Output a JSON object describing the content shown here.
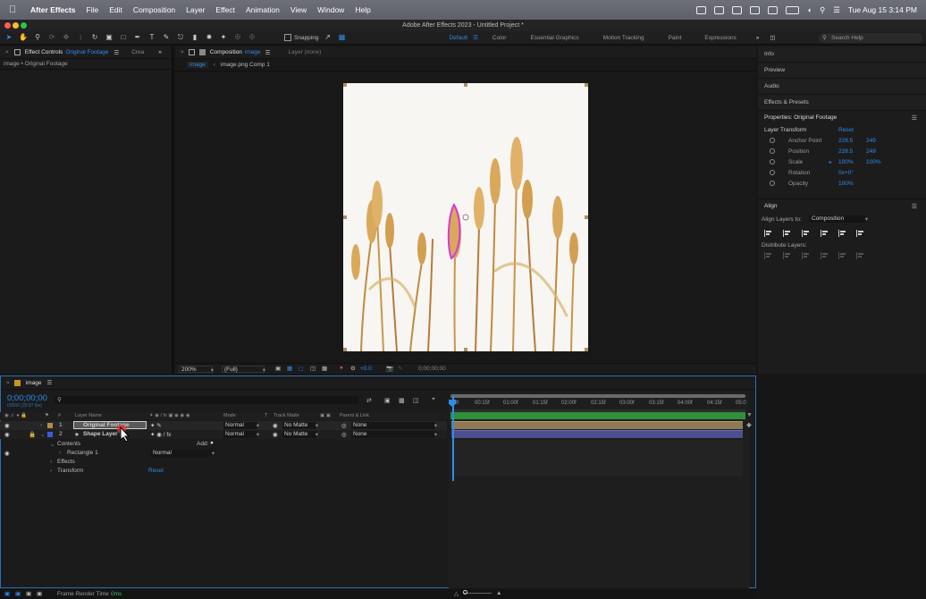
{
  "menubar": {
    "app_name": "After Effects",
    "items": [
      "File",
      "Edit",
      "Composition",
      "Layer",
      "Effect",
      "Animation",
      "View",
      "Window",
      "Help"
    ],
    "clock": "Tue Aug 15  3:14 PM"
  },
  "window": {
    "title": "Adobe After Effects 2023 - Untitled Project *"
  },
  "toolbar": {
    "snapping_label": "Snapping",
    "workspaces": [
      "Default",
      "Color",
      "Essential Graphics",
      "Motion Tracking",
      "Paint",
      "Expressions"
    ],
    "active_workspace": "Default",
    "search_placeholder": "Search Help"
  },
  "effect_controls": {
    "tab_label": "Effect Controls",
    "tab_layer": "Original Footage",
    "tab2_label": "Crea",
    "breadcrumb": "image • Original Footage"
  },
  "composition": {
    "tab_label": "Composition",
    "tab_comp": "image",
    "layer_tab": "Layer (none)",
    "nav_current": "image",
    "nav_child": "image.png Comp 1",
    "zoom": "200%",
    "resolution": "(Full)",
    "exposure": "+0.0",
    "timecode": "0;00;00;00"
  },
  "right_panel": {
    "sections": [
      "Info",
      "Preview",
      "Audio",
      "Effects & Presets"
    ],
    "properties_title": "Properties: Original Footage",
    "layer_transform": "Layer Transform",
    "reset_label": "Reset",
    "properties": [
      {
        "label": "Anchor Point",
        "v1": "228.5",
        "v2": "249"
      },
      {
        "label": "Position",
        "v1": "228.5",
        "v2": "249"
      },
      {
        "label": "Scale",
        "v1": "100%",
        "v2": "100%"
      },
      {
        "label": "Rotation",
        "v1": "0x+0°",
        "v2": ""
      },
      {
        "label": "Opacity",
        "v1": "100%",
        "v2": ""
      }
    ],
    "align_title": "Align",
    "align_layers_to_label": "Align Layers to:",
    "align_layers_to_value": "Composition",
    "distribute_label": "Distribute Layers:"
  },
  "timeline": {
    "tab_label": "image",
    "timecode": "0;00;00;00",
    "fps": "00000 (29.97 fps)",
    "columns": {
      "layer_name": "Layer Name",
      "mode": "Mode",
      "t": "T",
      "track_matte": "Track Matte",
      "parent": "Parent & Link"
    },
    "layers": [
      {
        "index": "1",
        "name": "Original Footage",
        "mode": "Normal",
        "matte": "No Matte",
        "parent": "None",
        "color": "#b58a4a"
      },
      {
        "index": "2",
        "name": "Shape Layer 1",
        "mode": "Normal",
        "matte": "No Matte",
        "parent": "None",
        "color": "#3a5bd9"
      }
    ],
    "sub_rows": {
      "contents": "Contents",
      "add": "Add:",
      "rectangle": "Rectangle 1",
      "rect_mode": "Normal",
      "effects": "Effects",
      "transform": "Transform",
      "reset": "Reset"
    },
    "ruler": [
      "0f",
      "00:15f",
      "01:00f",
      "01:15f",
      "02:00f",
      "02:15f",
      "03:00f",
      "03:15f",
      "04:00f",
      "04:15f",
      "05:0"
    ],
    "frame_render_label": "Frame Render Time",
    "frame_render_value": "0ms"
  },
  "colors": {
    "accent": "#2d8ceb",
    "mask": "#d63ad6",
    "playhead": "#2d8ceb",
    "footage_bar": "#8f7a55",
    "shape_bar": "#4c4f8f"
  }
}
